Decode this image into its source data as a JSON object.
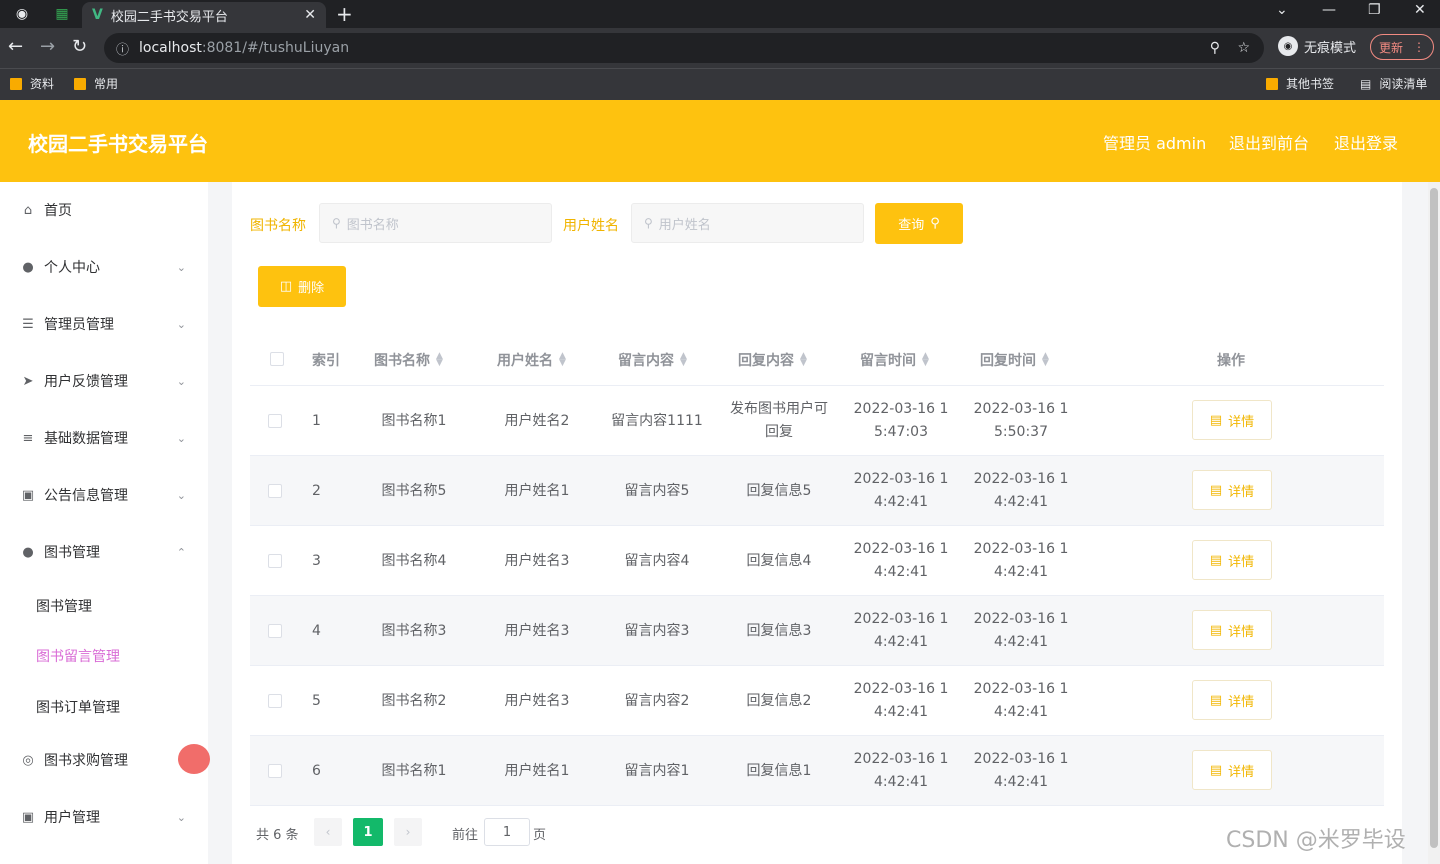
{
  "browser": {
    "tab_title": "校园二手书交易平台",
    "url_host": "localhost",
    "url_path": ":8081/#/tushuLiuyan",
    "incognito_label": "无痕模式",
    "update_label": "更新",
    "bookmarks": [
      "资料",
      "常用"
    ],
    "other_bookmarks": "其他书签",
    "reading_list": "阅读清单"
  },
  "header": {
    "title": "校园二手书交易平台",
    "admin_label": "管理员 admin",
    "to_front_label": "退出到前台",
    "logout_label": "退出登录"
  },
  "sidebar": {
    "items": [
      {
        "label": "首页",
        "icon": "home-icon"
      },
      {
        "label": "个人中心",
        "icon": "user-icon"
      },
      {
        "label": "管理员管理",
        "icon": "menu-icon"
      },
      {
        "label": "用户反馈管理",
        "icon": "send-icon"
      },
      {
        "label": "基础数据管理",
        "icon": "sliders-icon"
      },
      {
        "label": "公告信息管理",
        "icon": "monitor-icon"
      },
      {
        "label": "图书管理",
        "icon": "user-icon"
      },
      {
        "label": "图书求购管理",
        "icon": "circle-icon"
      },
      {
        "label": "用户管理",
        "icon": "monitor-icon"
      }
    ],
    "sub_items": [
      "图书管理",
      "图书留言管理",
      "图书订单管理"
    ]
  },
  "search": {
    "book_label": "图书名称",
    "book_placeholder": "图书名称",
    "user_label": "用户姓名",
    "user_placeholder": "用户姓名",
    "query_button": "查询",
    "delete_button": "删除"
  },
  "table": {
    "headers": [
      "索引",
      "图书名称",
      "用户姓名",
      "留言内容",
      "回复内容",
      "留言时间",
      "回复时间",
      "操作"
    ],
    "rows": [
      {
        "index": "1",
        "book": "图书名称1",
        "user": "用户姓名2",
        "content": "留言内容1111",
        "reply_l1": "发布图书用户可",
        "reply_l2": "回复",
        "time1_l1": "2022-03-16 1",
        "time1_l2": "5:47:03",
        "time2_l1": "2022-03-16 1",
        "time2_l2": "5:50:37"
      },
      {
        "index": "2",
        "book": "图书名称5",
        "user": "用户姓名1",
        "content": "留言内容5",
        "reply_l1": "回复信息5",
        "reply_l2": "",
        "time1_l1": "2022-03-16 1",
        "time1_l2": "4:42:41",
        "time2_l1": "2022-03-16 1",
        "time2_l2": "4:42:41"
      },
      {
        "index": "3",
        "book": "图书名称4",
        "user": "用户姓名3",
        "content": "留言内容4",
        "reply_l1": "回复信息4",
        "reply_l2": "",
        "time1_l1": "2022-03-16 1",
        "time1_l2": "4:42:41",
        "time2_l1": "2022-03-16 1",
        "time2_l2": "4:42:41"
      },
      {
        "index": "4",
        "book": "图书名称3",
        "user": "用户姓名3",
        "content": "留言内容3",
        "reply_l1": "回复信息3",
        "reply_l2": "",
        "time1_l1": "2022-03-16 1",
        "time1_l2": "4:42:41",
        "time2_l1": "2022-03-16 1",
        "time2_l2": "4:42:41"
      },
      {
        "index": "5",
        "book": "图书名称2",
        "user": "用户姓名3",
        "content": "留言内容2",
        "reply_l1": "回复信息2",
        "reply_l2": "",
        "time1_l1": "2022-03-16 1",
        "time1_l2": "4:42:41",
        "time2_l1": "2022-03-16 1",
        "time2_l2": "4:42:41"
      },
      {
        "index": "6",
        "book": "图书名称1",
        "user": "用户姓名1",
        "content": "留言内容1",
        "reply_l1": "回复信息1",
        "reply_l2": "",
        "time1_l1": "2022-03-16 1",
        "time1_l2": "4:42:41",
        "time2_l1": "2022-03-16 1",
        "time2_l2": "4:42:41"
      }
    ],
    "detail_label": "详情"
  },
  "pagination": {
    "total": "共 6 条",
    "current_page": "1",
    "goto_label": "前往",
    "goto_value": "1",
    "page_suffix": "页"
  },
  "watermark": "CSDN @米罗毕设",
  "colors": {
    "accent": "#fec20f",
    "active_submenu": "#d96bd6",
    "current_page": "#13b96a"
  }
}
